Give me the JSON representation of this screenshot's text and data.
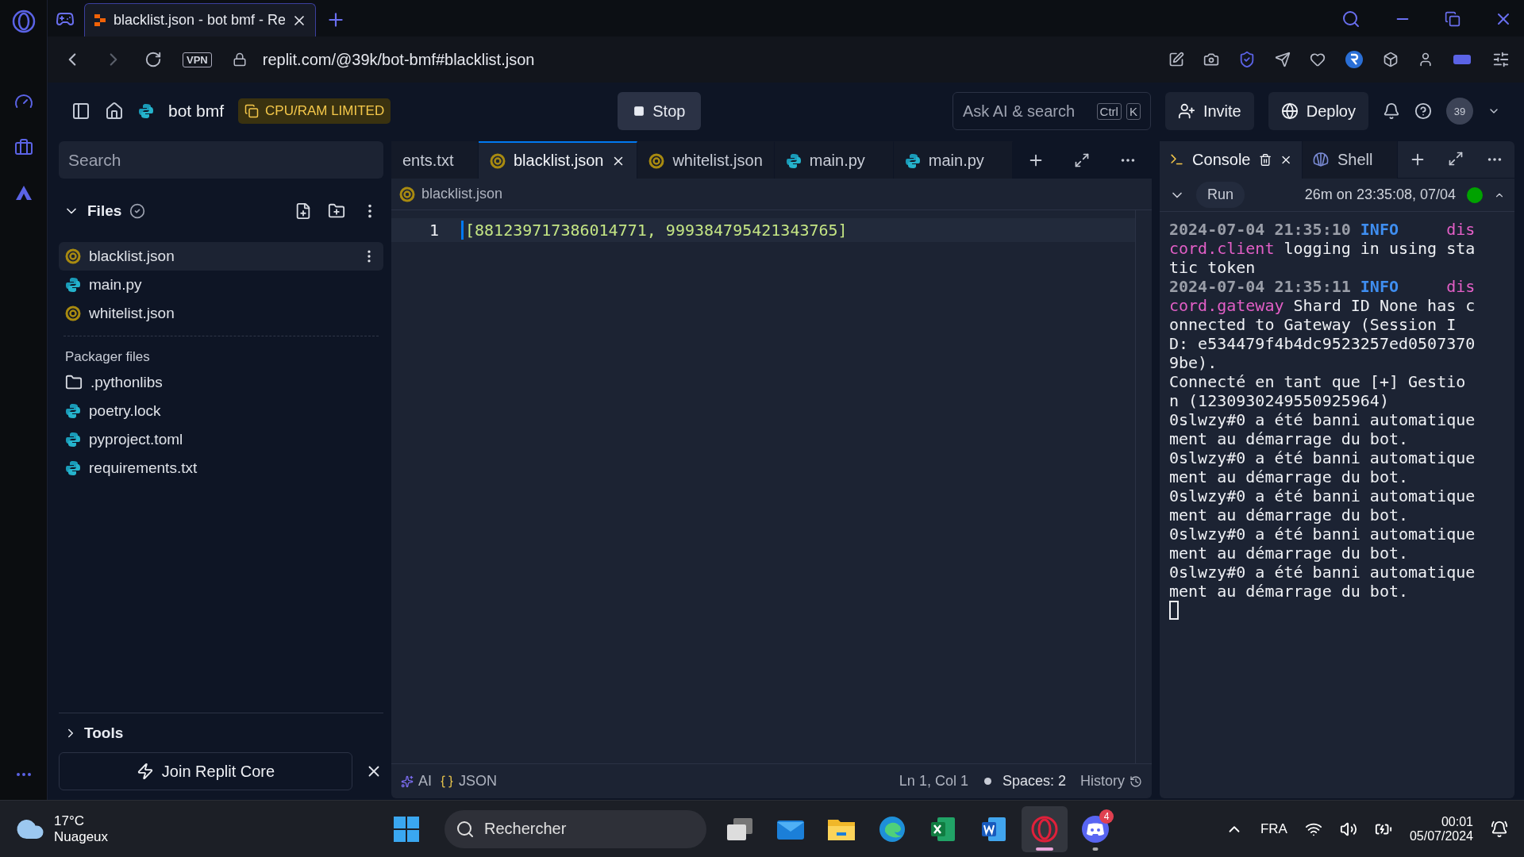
{
  "browser": {
    "tab_title": "blacklist.json - bot bmf - Re",
    "url": "replit.com/@39k/bot-bmf#blacklist.json",
    "vpn": "VPN"
  },
  "header": {
    "project": "bot bmf",
    "limit_badge": "CPU/RAM LIMITED",
    "stop": "Stop",
    "search": "Ask AI & search",
    "keys": [
      "Ctrl",
      "K"
    ],
    "invite": "Invite",
    "deploy": "Deploy",
    "avatar": "39"
  },
  "sidebar": {
    "search": {
      "placeholder": "Search"
    },
    "files_title": "Files",
    "files": [
      {
        "name": "blacklist.json",
        "kind": "json",
        "selected": true
      },
      {
        "name": "main.py",
        "kind": "python",
        "selected": false
      },
      {
        "name": "whitelist.json",
        "kind": "json",
        "selected": false
      }
    ],
    "packager_title": "Packager files",
    "packager_files": [
      {
        "name": ".pythonlibs",
        "kind": "folder"
      },
      {
        "name": "poetry.lock",
        "kind": "python"
      },
      {
        "name": "pyproject.toml",
        "kind": "python"
      },
      {
        "name": "requirements.txt",
        "kind": "python"
      }
    ],
    "tools": "Tools",
    "join": "Join Replit Core"
  },
  "editor": {
    "tabs": [
      {
        "label": "ents.txt",
        "kind": "text",
        "selected": false
      },
      {
        "label": "blacklist.json",
        "kind": "json",
        "selected": true
      },
      {
        "label": "whitelist.json",
        "kind": "json",
        "selected": false
      },
      {
        "label": "main.py",
        "kind": "python",
        "selected": false
      },
      {
        "label": "main.py",
        "kind": "python",
        "selected": false
      }
    ],
    "breadcrumb": "blacklist.json",
    "lines": [
      {
        "number": "1",
        "code": "[881239717386014771, 999384795421343765]"
      }
    ],
    "status": {
      "ai": "AI",
      "language": "JSON",
      "position": "Ln 1, Col 1",
      "spaces": "Spaces: 2",
      "history": "History"
    }
  },
  "console": {
    "tabs": [
      {
        "label": "Console",
        "kind": "console",
        "selected": true
      },
      {
        "label": "Shell",
        "kind": "shell",
        "selected": false
      }
    ],
    "run": "Run",
    "run_info": "26m on 23:35:08, 07/04",
    "running": true,
    "output": [
      {
        "kind": "log",
        "time": "2024-07-04 21:35:10",
        "level": "INFO",
        "logger": "discord.client",
        "message": "logging in using static token"
      },
      {
        "kind": "log",
        "time": "2024-07-04 21:35:11",
        "level": "INFO",
        "logger": "discord.gateway",
        "message": "Shard ID None has connected to Gateway (Session ID: e534479f4b4dc9523257ed05073709be)."
      },
      {
        "kind": "text",
        "text": "Connecté en tant que [+] Gestion (1230930249550925964)"
      },
      {
        "kind": "text",
        "text": "0slwzy#0 a été banni automatiquement au démarrage du bot."
      },
      {
        "kind": "text",
        "text": "0slwzy#0 a été banni automatiquement au démarrage du bot."
      },
      {
        "kind": "text",
        "text": "0slwzy#0 a été banni automatiquement au démarrage du bot."
      },
      {
        "kind": "text",
        "text": "0slwzy#0 a été banni automatiquement au démarrage du bot."
      },
      {
        "kind": "text",
        "text": "0slwzy#0 a été banni automatiquement au démarrage du bot."
      }
    ]
  },
  "taskbar": {
    "weather": {
      "temp": "17°C",
      "condition": "Nuageux"
    },
    "search": {
      "placeholder": "Rechercher"
    },
    "apps": [
      {
        "kind": "windows",
        "selected": false,
        "open": false
      },
      {
        "kind": "taskview",
        "selected": false,
        "open": false
      },
      {
        "kind": "mail",
        "selected": false,
        "open": false
      },
      {
        "kind": "explorer",
        "selected": false,
        "open": false
      },
      {
        "kind": "edge",
        "selected": false,
        "open": false
      },
      {
        "kind": "excel",
        "selected": false,
        "open": false
      },
      {
        "kind": "word",
        "selected": false,
        "open": false
      },
      {
        "kind": "opera",
        "selected": true,
        "open": true
      },
      {
        "kind": "discord",
        "selected": false,
        "open": true,
        "badge": "4"
      }
    ],
    "language": "FRA",
    "time": "00:01",
    "date": "05/07/2024"
  }
}
